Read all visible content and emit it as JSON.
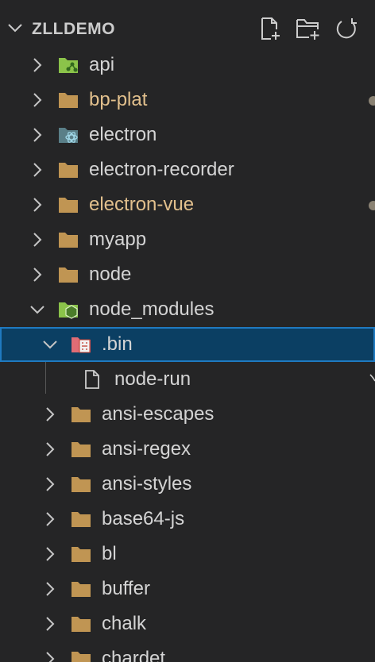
{
  "explorer": {
    "title": "ZLLDEMO",
    "actions": [
      "new-file",
      "new-folder",
      "refresh"
    ]
  },
  "tree": [
    {
      "label": "api",
      "level": 0,
      "expanded": false,
      "icon": "api-folder-icon",
      "modified": false,
      "selected": false
    },
    {
      "label": "bp-plat",
      "level": 0,
      "expanded": false,
      "icon": "folder-icon",
      "modified": true,
      "selected": false
    },
    {
      "label": "electron",
      "level": 0,
      "expanded": false,
      "icon": "electron-folder-icon",
      "modified": false,
      "selected": false
    },
    {
      "label": "electron-recorder",
      "level": 0,
      "expanded": false,
      "icon": "folder-icon",
      "modified": false,
      "selected": false
    },
    {
      "label": "electron-vue",
      "level": 0,
      "expanded": false,
      "icon": "folder-icon",
      "modified": true,
      "selected": false
    },
    {
      "label": "myapp",
      "level": 0,
      "expanded": false,
      "icon": "folder-icon",
      "modified": false,
      "selected": false
    },
    {
      "label": "node",
      "level": 0,
      "expanded": false,
      "icon": "folder-icon",
      "modified": false,
      "selected": false
    },
    {
      "label": "node_modules",
      "level": 0,
      "expanded": true,
      "icon": "node-modules-folder-icon",
      "modified": false,
      "selected": false
    },
    {
      "label": ".bin",
      "level": 1,
      "expanded": true,
      "icon": "binary-folder-icon",
      "modified": false,
      "selected": true
    },
    {
      "label": "node-run",
      "level": 2,
      "expanded": null,
      "icon": "file-icon",
      "modified": false,
      "selected": false
    },
    {
      "label": "ansi-escapes",
      "level": 1,
      "expanded": false,
      "icon": "folder-icon",
      "modified": false,
      "selected": false
    },
    {
      "label": "ansi-regex",
      "level": 1,
      "expanded": false,
      "icon": "folder-icon",
      "modified": false,
      "selected": false
    },
    {
      "label": "ansi-styles",
      "level": 1,
      "expanded": false,
      "icon": "folder-icon",
      "modified": false,
      "selected": false
    },
    {
      "label": "base64-js",
      "level": 1,
      "expanded": false,
      "icon": "folder-icon",
      "modified": false,
      "selected": false
    },
    {
      "label": "bl",
      "level": 1,
      "expanded": false,
      "icon": "folder-icon",
      "modified": false,
      "selected": false
    },
    {
      "label": "buffer",
      "level": 1,
      "expanded": false,
      "icon": "folder-icon",
      "modified": false,
      "selected": false
    },
    {
      "label": "chalk",
      "level": 1,
      "expanded": false,
      "icon": "folder-icon",
      "modified": false,
      "selected": false
    },
    {
      "label": "chardet",
      "level": 1,
      "expanded": false,
      "icon": "folder-icon",
      "modified": false,
      "selected": false
    }
  ],
  "colors": {
    "background": "#252526",
    "text": "#d4d4d4",
    "modified_text": "#e2c08d",
    "folder": "#c09553",
    "selection_bg": "#0b3f63",
    "selection_border": "#1f7ac0"
  }
}
